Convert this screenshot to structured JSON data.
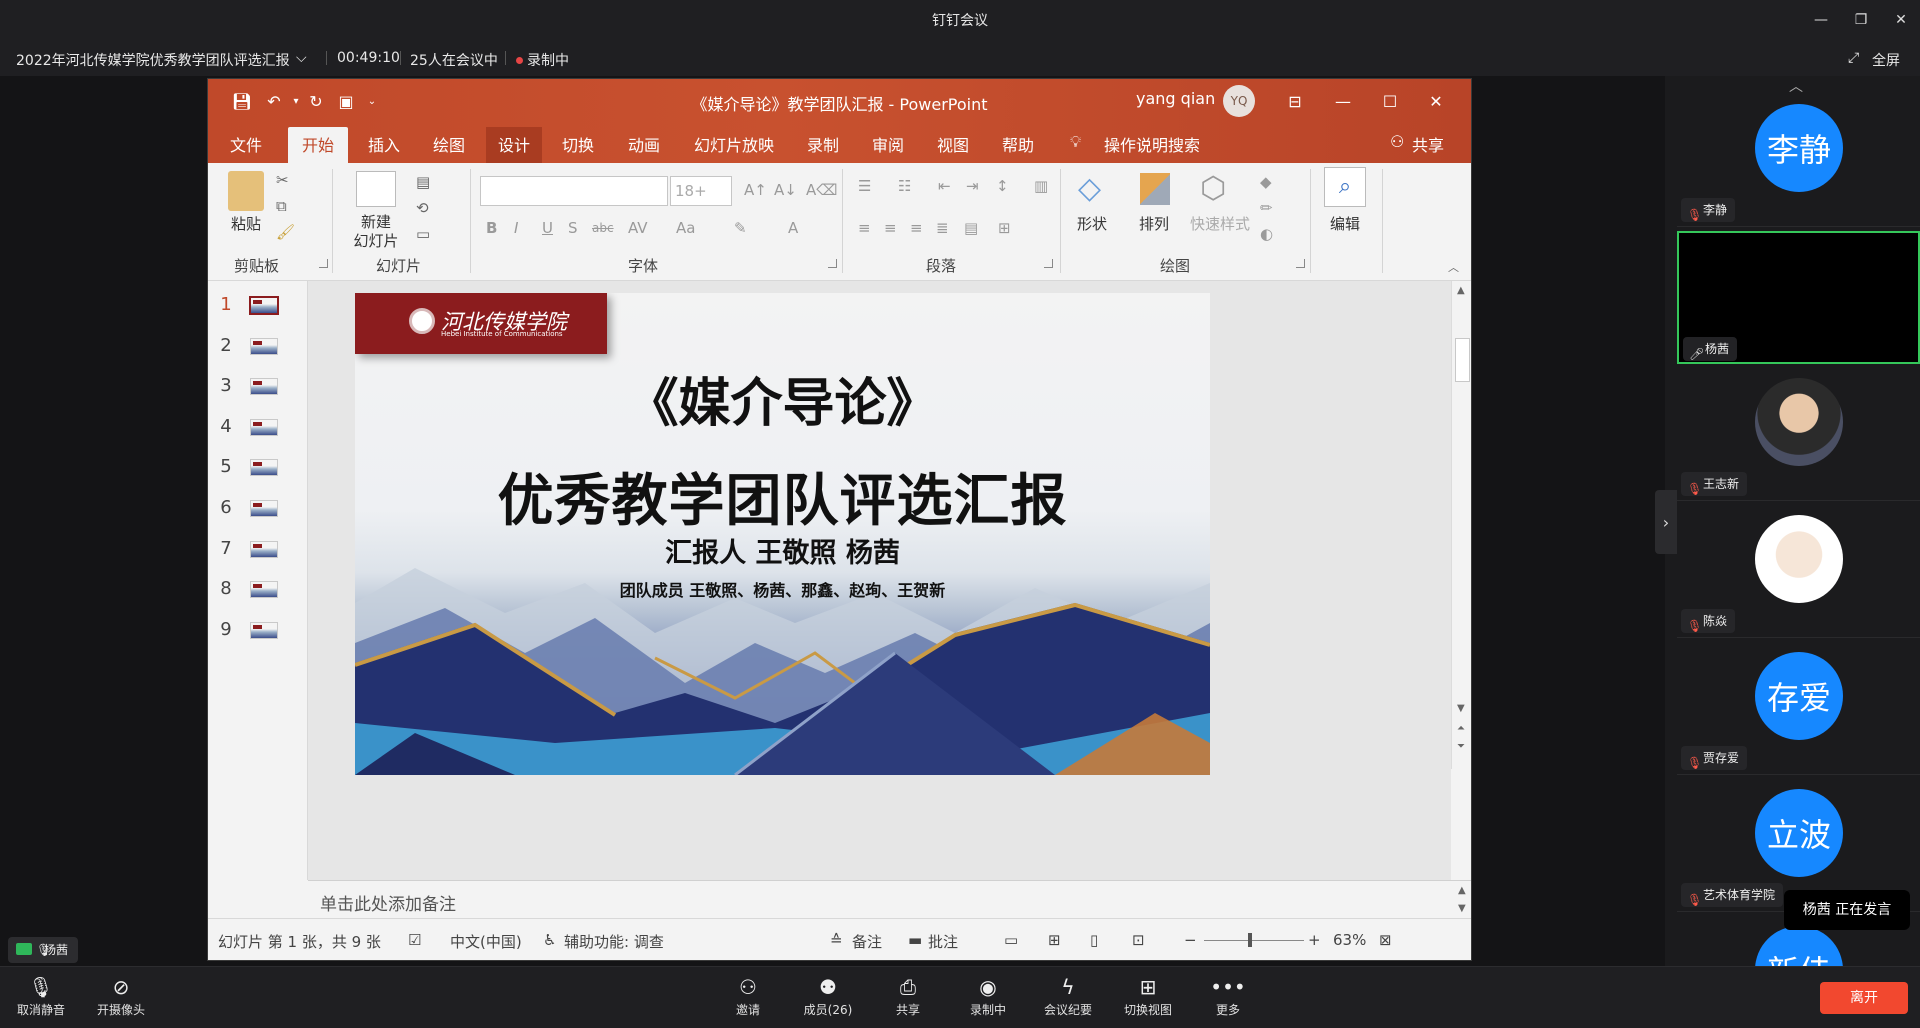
{
  "app": {
    "title": "钉钉会议",
    "fullscreen_label": "全屏"
  },
  "meeting": {
    "name": "2022年河北传媒学院优秀教学团队评选汇报",
    "elapsed": "00:49:10",
    "participants_text": "25人在会议中",
    "recording_text": "录制中"
  },
  "ppt": {
    "title": "《媒介导论》教学团队汇报 - PowerPoint",
    "user_name": "yang qian",
    "user_initials": "YQ",
    "share_label": "共享",
    "tabs": [
      "文件",
      "开始",
      "插入",
      "绘图",
      "设计",
      "切换",
      "动画",
      "幻灯片放映",
      "录制",
      "审阅",
      "视图",
      "帮助"
    ],
    "search_label": "操作说明搜索",
    "ribbon": {
      "paste": "粘贴",
      "clipboard": "剪贴板",
      "new_slide_1": "新建",
      "new_slide_2": "幻灯片",
      "slides": "幻灯片",
      "font_size": "18+",
      "font": "字体",
      "paragraph": "段落",
      "shape": "形状",
      "arrange": "排列",
      "quick_style": "快速样式",
      "drawing": "绘图",
      "editing": "编辑"
    },
    "thumbnails": [
      "1",
      "2",
      "3",
      "4",
      "5",
      "6",
      "7",
      "8",
      "9"
    ],
    "slide": {
      "logo_cn": "河北传媒学院",
      "logo_en": "Hebei Institute of Communications",
      "title1": "《媒介导论》",
      "title2": "优秀教学团队评选汇报",
      "presenter": "汇报人 王敬照 杨茜",
      "members": "团队成员 王敬照、杨茜、那鑫、赵珣、王贺新"
    },
    "notes_placeholder": "单击此处添加备注",
    "status": {
      "slide_info": "幻灯片 第 1 张，共 9 张",
      "language": "中文(中国)",
      "accessibility": "辅助功能: 调查",
      "notes": "备注",
      "comments": "批注",
      "zoom": "63%"
    }
  },
  "participants": [
    {
      "avatar_text": "李静",
      "name": "李静",
      "type": "text",
      "muted": true
    },
    {
      "avatar_text": "",
      "name": "杨茜",
      "type": "video",
      "muted": false
    },
    {
      "avatar_text": "",
      "name": "王志新",
      "type": "photo",
      "muted": true
    },
    {
      "avatar_text": "",
      "name": "陈焱",
      "type": "cartoon",
      "muted": true
    },
    {
      "avatar_text": "存爱",
      "name": "贾存爱",
      "type": "text",
      "muted": true
    },
    {
      "avatar_text": "立波",
      "name": "艺术体育学院",
      "type": "text",
      "muted": true
    },
    {
      "avatar_text": "新佳",
      "name": "",
      "type": "text",
      "muted": true
    }
  ],
  "speaking": {
    "name": "杨茜",
    "label": "正在发言"
  },
  "self": {
    "name": "杨茜"
  },
  "toolbar": {
    "unmute": "取消静音",
    "camera": "开摄像头",
    "invite": "邀请",
    "members": "成员(26)",
    "share": "共享",
    "recording": "录制中",
    "minutes": "会议纪要",
    "switch_view": "切换视图",
    "more": "更多",
    "leave": "离开"
  },
  "colors": {
    "ppt_accent": "#c0492a",
    "avatar_blue": "#1688ff",
    "leave_red": "#f2482f",
    "speaking_green": "#35c75a"
  }
}
